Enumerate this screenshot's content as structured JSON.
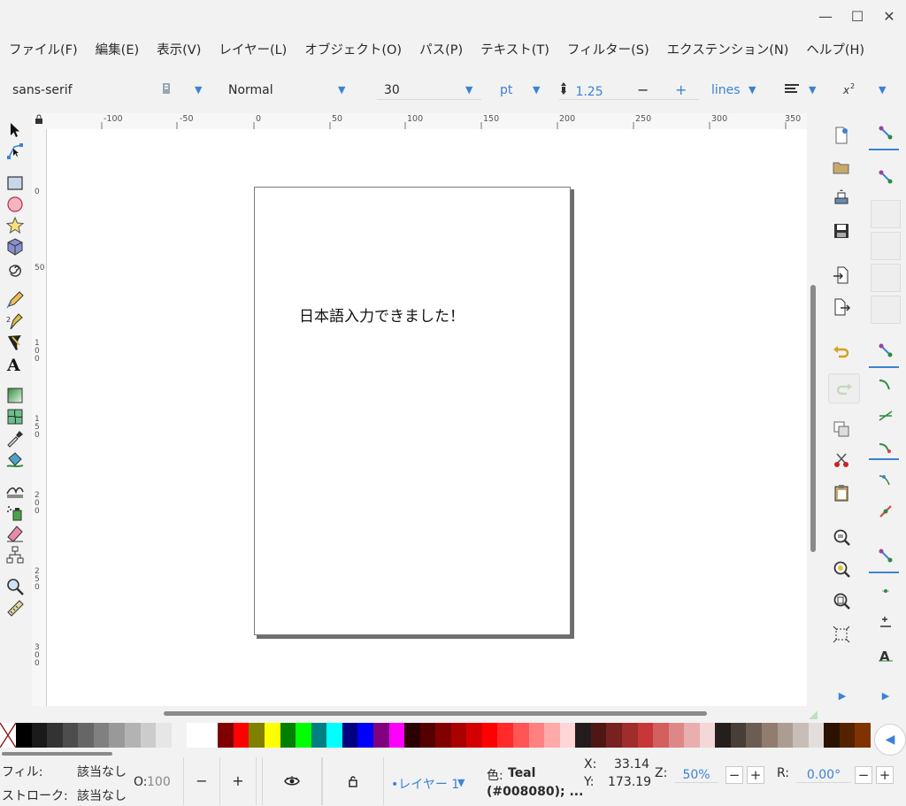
{
  "window": {
    "minimize": "—",
    "maximize": "☐",
    "close": "✕"
  },
  "menu": [
    "ファイル(F)",
    "編集(E)",
    "表示(V)",
    "レイヤー(L)",
    "オブジェクト(O)",
    "パス(P)",
    "テキスト(T)",
    "フィルター(S)",
    "エクステンション(N)",
    "ヘルプ(H)"
  ],
  "text_toolbar": {
    "font_family": "sans-serif",
    "font_style": "Normal",
    "font_size": "30",
    "unit": "pt",
    "line_spacing": "1.25",
    "minus": "−",
    "plus": "+",
    "spacing_mode": "lines"
  },
  "ruler": {
    "horizontal": [
      "-100",
      "-50",
      "0",
      "50",
      "100",
      "150",
      "200",
      "250",
      "300",
      "350"
    ],
    "vertical": [
      "0",
      "50",
      "100",
      "150",
      "200",
      "250",
      "300"
    ]
  },
  "canvas": {
    "text": "日本語入力できました！"
  },
  "palette": [
    "#000000",
    "#1a1a1a",
    "#333333",
    "#4d4d4d",
    "#666666",
    "#808080",
    "#999999",
    "#b3b3b3",
    "#cccccc",
    "#e6e6e6",
    "#f2f2f2",
    "#ffffff",
    "#ffffff",
    "#800000",
    "#ff0000",
    "#808000",
    "#ffff00",
    "#008000",
    "#00ff00",
    "#008080",
    "#00ffff",
    "#000080",
    "#0000ff",
    "#800080",
    "#ff00ff",
    "#2b0000",
    "#550000",
    "#800000",
    "#aa0000",
    "#d40000",
    "#ff0000",
    "#ff2a2a",
    "#ff5555",
    "#ff8080",
    "#ffaaaa",
    "#ffd5d5",
    "#241c1c",
    "#501616",
    "#782121",
    "#a02c2c",
    "#c83737",
    "#d35f5f",
    "#de8787",
    "#e9afaf",
    "#f4d7d7",
    "#241f1c",
    "#483e37",
    "#6c5d53",
    "#917c6f",
    "#ac9d93",
    "#c8beb7",
    "#e3dedb",
    "#2b1100",
    "#552200",
    "#803300"
  ],
  "status": {
    "fill_label": "フィル:",
    "fill_value": "該当なし",
    "stroke_label": "ストローク:",
    "stroke_value": "該当なし",
    "opacity_label": "O:",
    "opacity_value": "100",
    "minus": "−",
    "plus": "+",
    "layer": "•レイヤー 1",
    "color_label": "色:",
    "color_name": "Teal",
    "color_hex": "(#008080); ...",
    "x_label": "X:",
    "x_value": "33.14",
    "y_label": "Y:",
    "y_value": "173.19",
    "zoom_label": "Z:",
    "zoom_value": "50%",
    "rotate_label": "R:",
    "rotate_value": "0.00°"
  },
  "colors": {
    "accent": "#3b82d6",
    "teal": "#008080"
  }
}
